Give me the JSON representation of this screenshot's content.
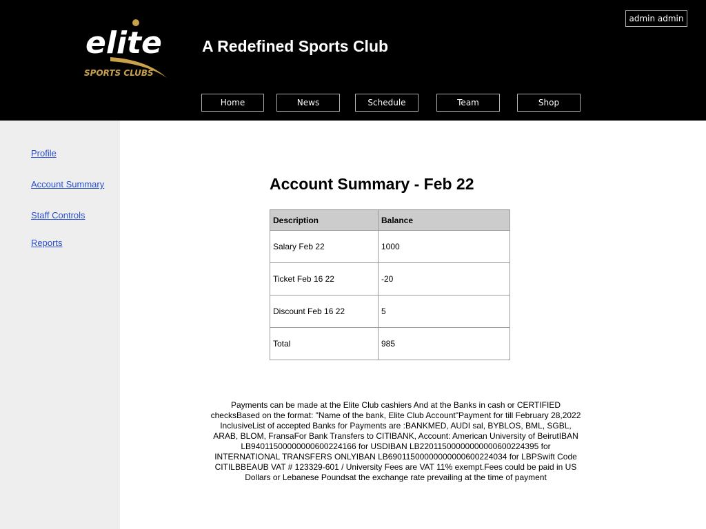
{
  "header": {
    "logo": {
      "word": "elite",
      "subtitle": "SPORTS CLUBS"
    },
    "site_title": "A Redefined Sports Club",
    "user_label": "admin admin",
    "nav": [
      {
        "label": "Home"
      },
      {
        "label": "News"
      },
      {
        "label": "Schedule"
      },
      {
        "label": "Team"
      },
      {
        "label": "Shop"
      }
    ]
  },
  "sidebar": {
    "items": [
      {
        "label": "Profile"
      },
      {
        "label": "Account Summary"
      },
      {
        "label": "Staff Controls"
      },
      {
        "label": "Reports"
      }
    ]
  },
  "main": {
    "title": "Account Summary - Feb 22",
    "table": {
      "headers": [
        "Description",
        "Balance"
      ],
      "rows": [
        [
          "Salary Feb 22",
          "1000"
        ],
        [
          "Ticket Feb 16 22",
          "-20"
        ],
        [
          "Discount Feb 16 22",
          "5"
        ],
        [
          "Total",
          "985"
        ]
      ]
    },
    "footer_text": "Payments can be made at the Elite Club cashiers And at the Banks in cash or CERTIFIED checksBased on the format: \"Name of the bank, Elite Club Account\"Payment for till February 28,2022 InclusiveList of accepted Banks for Payments are :BANKMED, AUDI sal, BYBLOS, BML, SGBL, ARAB, BLOM, FransaFor Bank Transfers to CITIBANK, Account: American University of BeirutIBAN LB94011500000000600224166 for USDIBAN LB22011500000000000600224395 for INTERNATIONAL TRANSFERS ONLYIBAN LB69011500000000000600224034 for LBPSwift Code CITILBBEAUB VAT # 123329-601 / University Fees are VAT 11% exempt.Fees could be paid in US Dollars or Lebanese Poundsat the exchange rate prevailing at the time of payment"
  },
  "colors": {
    "header_bg": "#000000",
    "sidebar_bg": "#eeeeee",
    "link": "#2a4fd0",
    "logo_gold": "#c9a14a",
    "table_header_bg": "#cccccc"
  }
}
